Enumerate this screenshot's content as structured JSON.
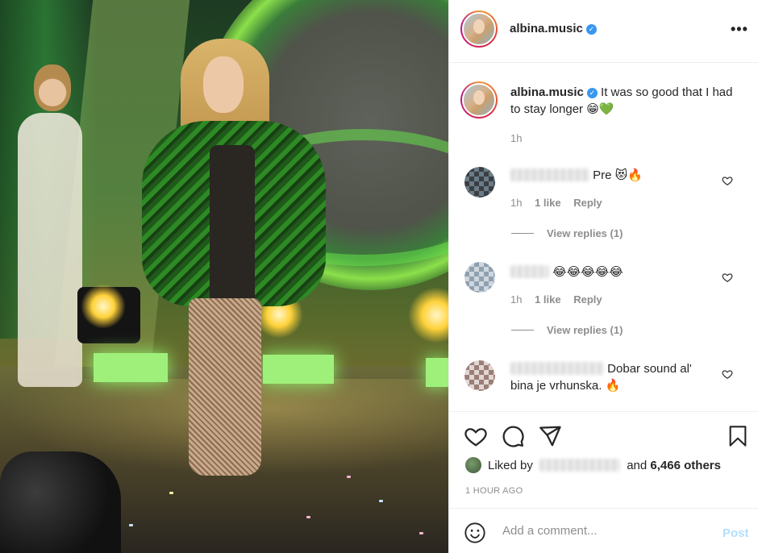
{
  "post": {
    "author": "albina.music",
    "verified": true,
    "caption": "It was so good that I had to stay longer 😁💚",
    "caption_time": "1h"
  },
  "comments": [
    {
      "text": "Pre 😻🔥",
      "time": "1h",
      "likes": "1 like",
      "reply": "Reply",
      "view_replies": "View replies (1)"
    },
    {
      "text": "😂😂😂😂😂",
      "time": "1h",
      "likes": "1 like",
      "reply": "Reply",
      "view_replies": "View replies (1)"
    },
    {
      "text": "Dobar sound al' bina je vrhunska. 🔥"
    }
  ],
  "engagement": {
    "liked_by_prefix": "Liked by",
    "and": "and",
    "others": "6,466 others",
    "posted": "1 HOUR AGO"
  },
  "compose": {
    "placeholder": "Add a comment...",
    "post_label": "Post"
  },
  "icons": {
    "more": "more-horizontal-icon",
    "like": "heart-icon",
    "comment": "comment-bubble-icon",
    "share": "paper-plane-icon",
    "save": "bookmark-icon",
    "emoji": "emoji-icon"
  },
  "colors": {
    "verified": "#3897f0",
    "muted": "#8e8e8e",
    "post_disabled": "#b2dffc",
    "text": "#262626"
  }
}
